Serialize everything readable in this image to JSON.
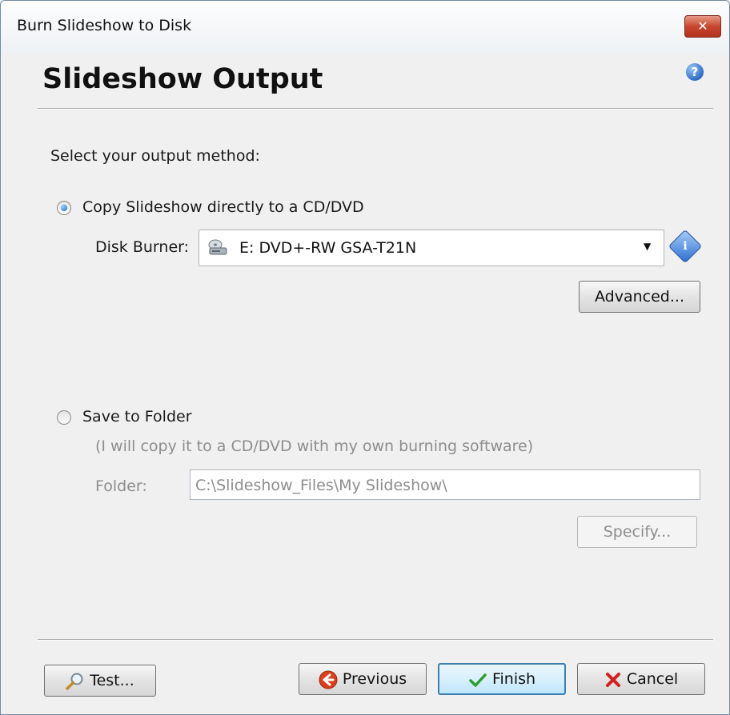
{
  "window": {
    "title": "Burn Slideshow to Disk",
    "close_glyph": "✕"
  },
  "header": {
    "title": "Slideshow Output",
    "help_glyph": "?"
  },
  "output": {
    "prompt": "Select your output method:",
    "option_disc": {
      "label": "Copy Slideshow directly to a CD/DVD",
      "selected": true,
      "burner_label": "Disk Burner:",
      "burner_value": "E:  DVD+-RW GSA-T21N",
      "info_glyph": "i",
      "advanced_button": "Advanced..."
    },
    "option_folder": {
      "label": "Save to Folder",
      "selected": false,
      "note": "(I will copy it to a CD/DVD with my own burning software)",
      "folder_label": "Folder:",
      "folder_value": "C:\\Slideshow_Files\\My Slideshow\\",
      "specify_button": "Specify..."
    }
  },
  "footer": {
    "test_button": "Test...",
    "previous_button": "Previous",
    "finish_button": "Finish",
    "cancel_button": "Cancel"
  },
  "icons": {
    "help": "help-icon",
    "info": "info-icon",
    "drive": "disc-drive-icon",
    "test": "magnifier-icon",
    "previous": "back-arrow-icon",
    "finish": "checkmark-icon",
    "cancel": "x-icon"
  },
  "colors": {
    "accent": "#3c7fb1",
    "cancel_red": "#d2201c",
    "finish_green": "#2e9e2e",
    "previous_red": "#d8401e"
  }
}
